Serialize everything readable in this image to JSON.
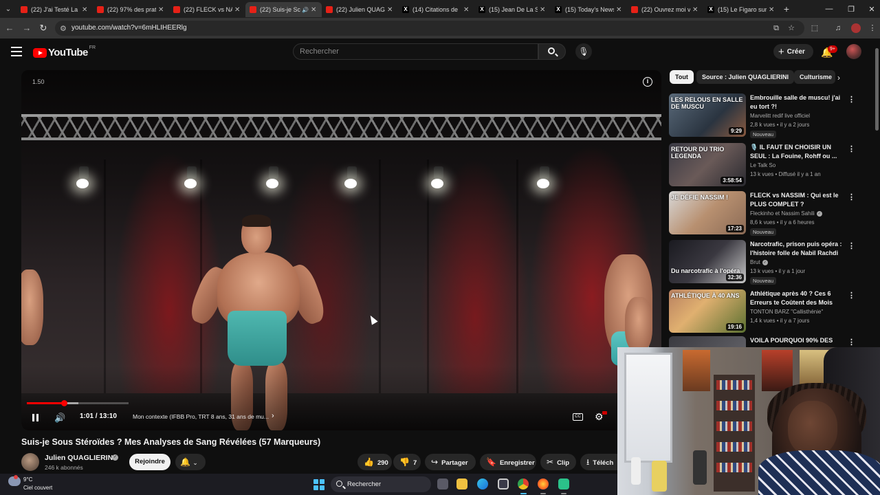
{
  "browser": {
    "tabs": [
      {
        "label": "(22) J'ai Testé La F",
        "icon": "youtube",
        "active": false
      },
      {
        "label": "(22) 97% des prati",
        "icon": "youtube",
        "active": false
      },
      {
        "label": "(22) FLECK vs NAS",
        "icon": "youtube",
        "active": false
      },
      {
        "label": "(22) Suis-je Sc",
        "icon": "youtube",
        "active": true
      },
      {
        "label": "(22) Julien QUAGL",
        "icon": "youtube",
        "active": false
      },
      {
        "label": "(14) Citations de",
        "icon": "x",
        "active": false
      },
      {
        "label": "(15) Jean De La S",
        "icon": "x",
        "active": false
      },
      {
        "label": "(15) Today's News",
        "icon": "x",
        "active": false
      },
      {
        "label": "(22) Ouvrez moi v",
        "icon": "youtube",
        "active": false
      },
      {
        "label": "(15) Le Figaro sur",
        "icon": "x",
        "active": false
      }
    ],
    "url": "youtube.com/watch?v=6mHLIHEERlg"
  },
  "header": {
    "logo": "YouTube",
    "region": "FR",
    "search_placeholder": "Rechercher",
    "create_label": "Créer",
    "notif_count": "9+"
  },
  "player": {
    "speed_overlay": "1.50",
    "current_time": "1:01 / 13:10",
    "chapter": "Mon contexte (IFBB Pro, TRT 8 ans, 31 ans de mu...",
    "progress_fraction": 0.08,
    "buffer_fraction": 0.11
  },
  "video": {
    "title": "Suis-je Sous Stéroïdes ? Mes Analyses de Sang Révélées (57 Marqueurs)",
    "channel": "Julien QUAGLIERINI",
    "subscribers": "246 k abonnés",
    "join_label": "Rejoindre",
    "likes": "290",
    "dislikes": "7",
    "share_label": "Partager",
    "save_label": "Enregistrer",
    "clip_label": "Clip",
    "download_label": "Téléch"
  },
  "sidebar": {
    "chips": [
      "Tout",
      "Source : Julien QUAGLIERINI",
      "Culturisme"
    ],
    "recommendations": [
      {
        "title": "Embrouille salle de muscu! j'ai eu tort ?!",
        "channel": "Marvelitt redif live officiel",
        "meta": "2,8 k vues • il y a 2 jours",
        "badge": "Nouveau",
        "duration": "9:29",
        "thumb_text": "LES RELOUS EN SALLE DE MUSCU",
        "verified": false
      },
      {
        "title": "🎙️ IL FAUT EN CHOISIR UN SEUL : La Fouine, Rohff ou ...",
        "channel": "Le Talk So",
        "meta": "13 k vues • Diffusé il y a 1 an",
        "badge": "",
        "duration": "3:58:54",
        "thumb_text": "RETOUR DU TRIO LEGENDA",
        "verified": false
      },
      {
        "title": "FLECK vs NASSIM : Qui est le PLUS COMPLET ?",
        "channel": "Fleckinho et Nassim Sahili",
        "meta": "8,6 k vues • il y a 6 heures",
        "badge": "Nouveau",
        "duration": "17:23",
        "thumb_text": "JE DÉFIE NASSIM !",
        "verified": true
      },
      {
        "title": "Narcotrafic, prison puis opéra : l'histoire folle de Nabil Rachdi",
        "channel": "Brut",
        "meta": "13 k vues • il y a 1 jour",
        "badge": "Nouveau",
        "duration": "32:36",
        "thumb_text": "Du narcotrafic à l'opéra",
        "verified": true
      },
      {
        "title": "Athlétique après 40 ? Ces 6 Erreurs te Coûtent des Mois",
        "channel": "TONTON BARZ \"Callisthénie\"",
        "meta": "1,4 k vues • il y a 7 jours",
        "badge": "",
        "duration": "19:16",
        "thumb_text": "ATHLÉTIQUE À 40 ANS",
        "verified": false
      },
      {
        "title": "VOILA POURQUOI 90% DES",
        "channel": "",
        "meta": "",
        "badge": "",
        "duration": "",
        "thumb_text": "",
        "verified": false
      }
    ]
  },
  "taskbar": {
    "temperature": "9°C",
    "weather": "Ciel couvert",
    "search_placeholder": "Rechercher"
  },
  "colors": {
    "youtube_red": "#ff0000",
    "background": "#0f0f0f",
    "accent_blue": "#4cc2ff"
  }
}
